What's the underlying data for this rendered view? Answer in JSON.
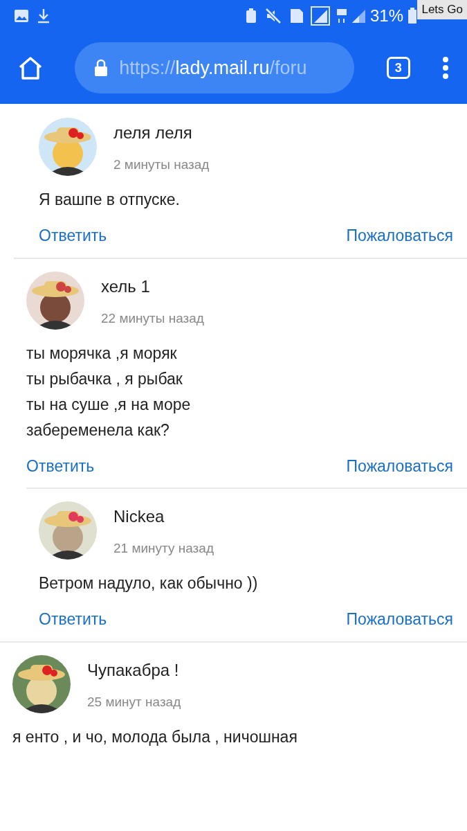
{
  "status_bar": {
    "battery": "31%",
    "overlay_label": "Lets Go"
  },
  "browser": {
    "url_scheme": "https://",
    "url_host": "lady.mail.ru",
    "url_path": "/foru",
    "tab_count": "3"
  },
  "thread": [
    {
      "children": [
        {
          "children": [
            {
              "author": "леля леля",
              "time": "2 минуты назад",
              "text": "Я вашпе в отпуске.",
              "reply": "Ответить",
              "report": "Пожаловаться"
            }
          ]
        },
        {
          "author": "хель 1",
          "time": "22 минуты назад",
          "text": "ты морячка ,я моряк\nты рыбачка , я рыбак\nты на суше ,я на море\nзабеременела как?",
          "reply": "Ответить",
          "report": "Пожаловаться",
          "children": [
            {
              "author": "Nickea",
              "time": "21 минуту назад",
              "text": "Ветром надуло, как обычно ))",
              "reply": "Ответить",
              "report": "Пожаловаться"
            }
          ]
        }
      ]
    },
    {
      "author": "Чупакабра !",
      "time": "25 минут назад",
      "text": "я енто , и чо, молода была , ничошная"
    }
  ]
}
